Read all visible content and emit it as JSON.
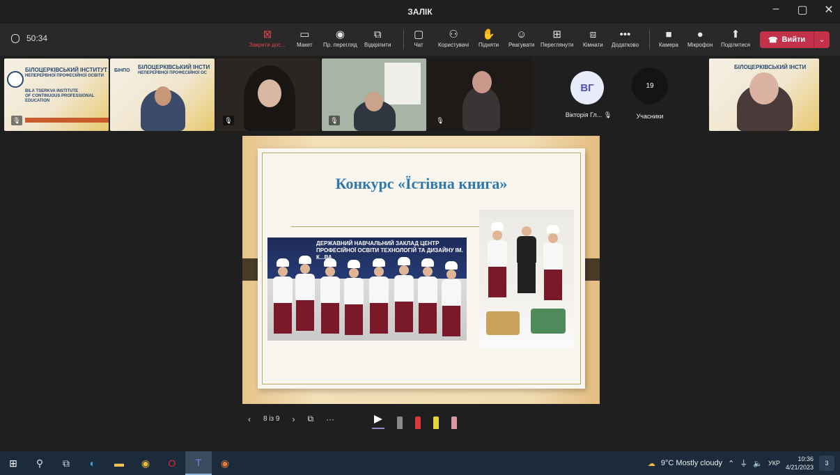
{
  "window": {
    "title": "ЗАЛІК",
    "controls": {
      "minimize": "–",
      "maximize": "▢",
      "close": "✕"
    }
  },
  "meeting": {
    "duration": "50:34"
  },
  "toolbar": {
    "items": [
      {
        "label": "Закрити дос...",
        "icon": "close-sharing-icon",
        "glyph": "⊠"
      },
      {
        "label": "Макет",
        "icon": "layout-icon",
        "glyph": "▭"
      },
      {
        "label": "Пр. перегляд",
        "icon": "eye-icon",
        "glyph": "◉"
      },
      {
        "label": "Відкріпити",
        "icon": "popout-icon",
        "glyph": "⧉"
      },
      {
        "label": "Чат",
        "icon": "chat-icon",
        "glyph": "▢"
      },
      {
        "label": "Користувачі",
        "icon": "people-icon",
        "glyph": "⚇"
      },
      {
        "label": "Підняти",
        "icon": "raise-hand-icon",
        "glyph": "✋"
      },
      {
        "label": "Реагувати",
        "icon": "smile-icon",
        "glyph": "☺"
      },
      {
        "label": "Переглянути",
        "icon": "view-icon",
        "glyph": "⊞"
      },
      {
        "label": "Кімнати",
        "icon": "rooms-icon",
        "glyph": "⧈"
      },
      {
        "label": "Додатково",
        "icon": "more-icon",
        "glyph": "•••"
      },
      {
        "label": "Камера",
        "icon": "camera-icon",
        "glyph": "■"
      },
      {
        "label": "Мікрофон",
        "icon": "mic-icon",
        "glyph": "●"
      },
      {
        "label": "Поділитися",
        "icon": "share-icon",
        "glyph": "⬆"
      }
    ],
    "leave_label": "Вийти",
    "leave_icon": "phone-hangup-icon"
  },
  "participants": {
    "banner1": {
      "line1": "БІЛОЦЕРКІВСЬКИЙ ІНСТИТУТ",
      "line2": "НЕПЕРЕРВНОЇ ПРОФЕСІЙНОЇ ОСВІТИ",
      "line3": "BILA TSERKVA INSTITUTE",
      "line4": "OF CONTINUOUS PROFESSIONAL",
      "line5": "EDUCATION"
    },
    "banner2": {
      "line1": "БІЛОЦЕРКІВСЬКИЙ ІНСТИ",
      "line2": "НЕПЕРЕРВНОЇ ПРОФЕСІЙНОЇ ОС",
      "tag": "БІНПО"
    },
    "avatar_initials": "ВГ",
    "avatar_name": "Вікторія Гл...",
    "participant_count": "19",
    "participant_count_label": "Учасники"
  },
  "slide": {
    "title": "Конкурс «Їстівна книга»",
    "photo_caption": "ДЕРЖАВНИЙ НАВЧАЛЬНИЙ ЗАКЛАД ЦЕНТР ПРОФЕСІЙНОЇ ОСВІТИ ТЕХНОЛОГІЙ ТА ДИЗАЙНУ ІМ. К...ВА",
    "page": "8 із 9"
  },
  "taskbar": {
    "weather": "9°C  Mostly cloudy",
    "lang": "УКР",
    "time": "10:36",
    "date": "4/21/2023",
    "notifications": "3"
  },
  "colors": {
    "leave": "#c4314b",
    "accent": "#4f52b2",
    "slide_title": "#2f79ac"
  }
}
